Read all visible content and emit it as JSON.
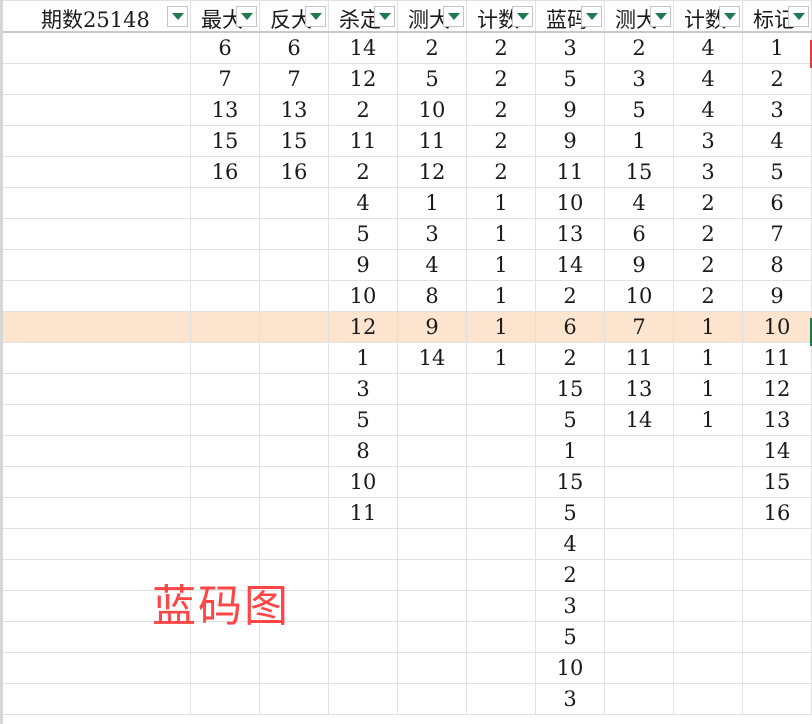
{
  "headers": [
    "期数25148",
    "最大",
    "反大",
    "杀定",
    "测大",
    "计数",
    "蓝码",
    "测大",
    "计数",
    "标记"
  ],
  "watermark": "蓝码图",
  "selected_row": 9,
  "rows": [
    [
      "",
      "6",
      "6",
      "14",
      "2",
      "2",
      "3",
      "2",
      "4",
      "1"
    ],
    [
      "",
      "7",
      "7",
      "12",
      "5",
      "2",
      "5",
      "3",
      "4",
      "2"
    ],
    [
      "",
      "13",
      "13",
      "2",
      "10",
      "2",
      "9",
      "5",
      "4",
      "3"
    ],
    [
      "",
      "15",
      "15",
      "11",
      "11",
      "2",
      "9",
      "1",
      "3",
      "4"
    ],
    [
      "",
      "16",
      "16",
      "2",
      "12",
      "2",
      "11",
      "15",
      "3",
      "5"
    ],
    [
      "",
      "",
      "",
      "4",
      "1",
      "1",
      "10",
      "4",
      "2",
      "6"
    ],
    [
      "",
      "",
      "",
      "5",
      "3",
      "1",
      "13",
      "6",
      "2",
      "7"
    ],
    [
      "",
      "",
      "",
      "9",
      "4",
      "1",
      "14",
      "9",
      "2",
      "8"
    ],
    [
      "",
      "",
      "",
      "10",
      "8",
      "1",
      "2",
      "10",
      "2",
      "9"
    ],
    [
      "",
      "",
      "",
      "12",
      "9",
      "1",
      "6",
      "7",
      "1",
      "10"
    ],
    [
      "",
      "",
      "",
      "1",
      "14",
      "1",
      "2",
      "11",
      "1",
      "11"
    ],
    [
      "",
      "",
      "",
      "3",
      "",
      "",
      "15",
      "13",
      "1",
      "12"
    ],
    [
      "",
      "",
      "",
      "5",
      "",
      "",
      "5",
      "14",
      "1",
      "13"
    ],
    [
      "",
      "",
      "",
      "8",
      "",
      "",
      "1",
      "",
      "",
      "14"
    ],
    [
      "",
      "",
      "",
      "10",
      "",
      "",
      "15",
      "",
      "",
      "15"
    ],
    [
      "",
      "",
      "",
      "11",
      "",
      "",
      "5",
      "",
      "",
      "16"
    ],
    [
      "",
      "",
      "",
      "",
      "",
      "",
      "4",
      "",
      "",
      ""
    ],
    [
      "",
      "",
      "",
      "",
      "",
      "",
      "2",
      "",
      "",
      ""
    ],
    [
      "",
      "",
      "",
      "",
      "",
      "",
      "3",
      "",
      "",
      ""
    ],
    [
      "",
      "",
      "",
      "",
      "",
      "",
      "5",
      "",
      "",
      ""
    ],
    [
      "",
      "",
      "",
      "",
      "",
      "",
      "10",
      "",
      "",
      ""
    ],
    [
      "",
      "",
      "",
      "",
      "",
      "",
      "3",
      "",
      "",
      ""
    ]
  ]
}
